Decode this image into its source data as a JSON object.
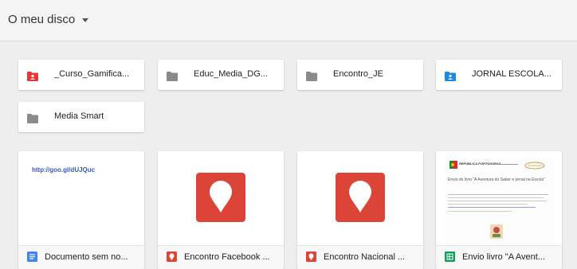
{
  "header": {
    "title": "O meu disco"
  },
  "folders": [
    {
      "name": "_Curso_Gamifica...",
      "icon": "shared-folder-icon",
      "color": "#e53935"
    },
    {
      "name": "Educ_Media_DG...",
      "icon": "folder-icon",
      "color": "#8a8a8a"
    },
    {
      "name": "Encontro_JE",
      "icon": "folder-icon",
      "color": "#8a8a8a"
    },
    {
      "name": "JORNAL ESCOLA...",
      "icon": "shared-folder-icon",
      "color": "#1e88e5"
    },
    {
      "name": "Media Smart",
      "icon": "folder-icon",
      "color": "#8a8a8a"
    }
  ],
  "files": [
    {
      "name": "Documento sem no...",
      "icon": "docs-icon",
      "icon_color": "#4285f4",
      "thumb_text": "http://goo.gl/dUJQuc"
    },
    {
      "name": "Encontro Facebook ...",
      "icon": "my-maps-icon",
      "icon_color": "#db4437"
    },
    {
      "name": "Encontro Nacional ...",
      "icon": "my-maps-icon",
      "icon_color": "#db4437"
    },
    {
      "name": "Envio livro \"A Avent...",
      "icon": "sheets-icon",
      "icon_color": "#0f9d58",
      "thumb": {
        "logo_text": "REPÚBLICA PORTUGUESA",
        "heading": "Envio do livro \"A Aventura do Saber e jornal na Escola\""
      }
    }
  ],
  "colors": {
    "maps_red": "#db4437",
    "link_blue": "#3b5bb5",
    "background": "#eeeeee"
  }
}
